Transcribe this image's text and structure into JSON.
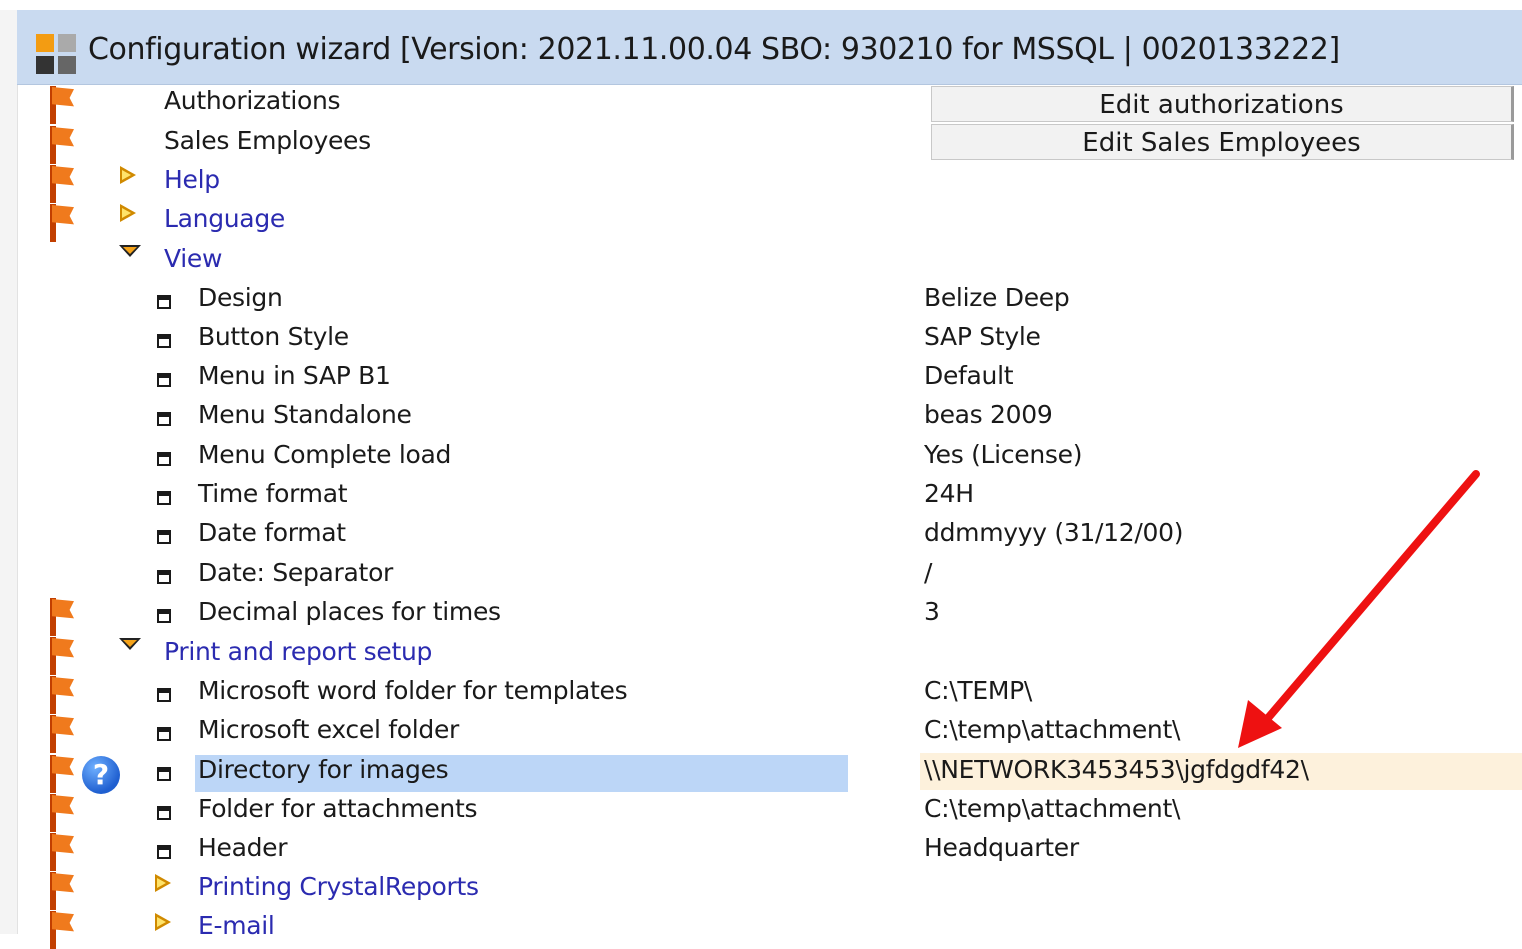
{
  "window": {
    "title": "Configuration wizard [Version: 2021.11.00.04 SBO: 930210 for MSSQL | 0020133222]"
  },
  "buttons": {
    "edit_authorizations": "Edit authorizations",
    "edit_sales_employees": "Edit Sales Employees"
  },
  "tree": {
    "authorizations": "Authorizations",
    "sales_employees": "Sales Employees",
    "help": "Help",
    "language": "Language",
    "view": "View",
    "view_items": [
      {
        "label": "Design",
        "value": "Belize Deep"
      },
      {
        "label": "Button Style",
        "value": "SAP Style"
      },
      {
        "label": "Menu in SAP B1",
        "value": "Default"
      },
      {
        "label": "Menu Standalone",
        "value": "beas 2009"
      },
      {
        "label": "Menu Complete load",
        "value": "Yes (License)"
      },
      {
        "label": "Time format",
        "value": "24H"
      },
      {
        "label": "Date format",
        "value": "ddmmyyy (31/12/00)"
      },
      {
        "label": "Date: Separator",
        "value": "/"
      },
      {
        "label": "Decimal places for times",
        "value": "3"
      }
    ],
    "print_setup": "Print and report setup",
    "print_items": [
      {
        "label": "Microsoft word folder for templates",
        "value": "C:\\TEMP\\"
      },
      {
        "label": "Microsoft excel folder",
        "value": "C:\\temp\\attachment\\"
      },
      {
        "label": "Directory for images",
        "value": "\\\\NETWORK3453453\\jgfdgdf42\\"
      },
      {
        "label": "Folder for attachments",
        "value": "C:\\temp\\attachment\\"
      },
      {
        "label": "Header",
        "value": "Headquarter"
      }
    ],
    "printing_crystal": "Printing CrystalReports",
    "email": "E-mail"
  },
  "icons": {
    "help_badge": "?"
  },
  "colors": {
    "titlebar": "#c9daf0",
    "selection": "#bcd6f7",
    "selected_value_bg": "#fdf1dc",
    "flag": "#f07a1d",
    "annotation_arrow": "#ee1111",
    "node_text": "#2b2bb0"
  }
}
